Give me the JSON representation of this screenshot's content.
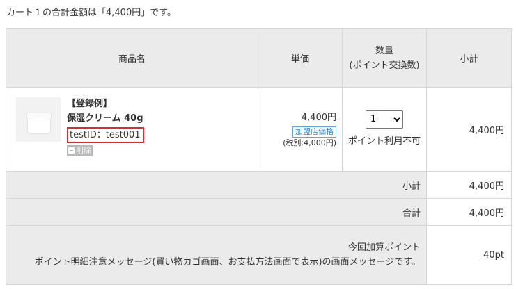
{
  "summary": "カート１の合計金額は「4,400円」です。",
  "table": {
    "headers": {
      "product": "商品名",
      "unit_price": "単価",
      "quantity": "数量\n(ポイント交換数)",
      "subtotal": "小計"
    },
    "item": {
      "name_line1": "【登録例】",
      "name_line2": "保湿クリーム 40g",
      "test_id": "testID：test001",
      "delete_label": "削除",
      "price": "4,400円",
      "price_badge": "加盟店価格",
      "tax_note": "(税別:4,000円)",
      "quantity_selected": "1",
      "point_note": "ポイント利用不可",
      "subtotal": "4,400円"
    },
    "summary_rows": {
      "subtotal_label": "小計",
      "subtotal_value": "4,400円",
      "total_label": "合計",
      "total_value": "4,400円"
    },
    "points": {
      "label": "今回加算ポイント",
      "message": "ポイント明細注意メッセージ(買い物カゴ画面、お支払方法画面で表示)の画面メッセージです。",
      "value": "40pt"
    }
  },
  "colors": {
    "header_bg": "#ebebeb",
    "border": "#d6d6d6",
    "highlight_box": "#e0282d",
    "badge_blue": "#2f8acb",
    "delete_bg": "#b9b9b9"
  }
}
